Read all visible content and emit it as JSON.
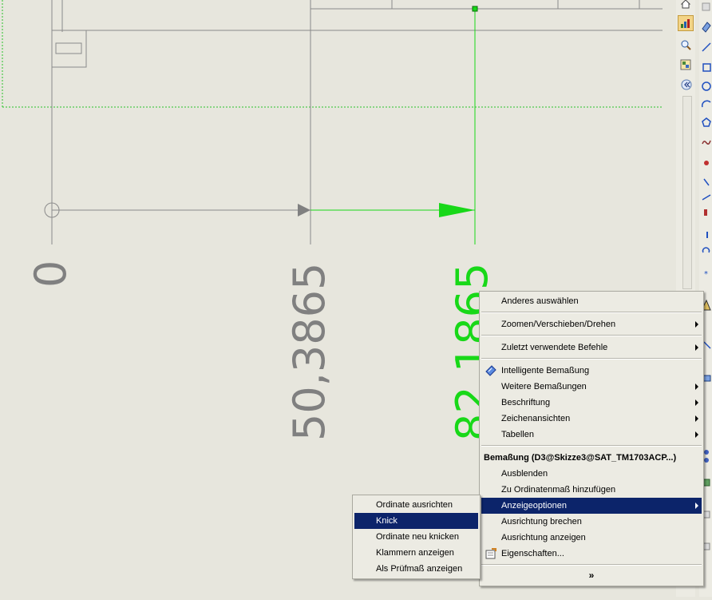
{
  "dimensions": [
    {
      "text": "0",
      "color": "gray"
    },
    {
      "text": "50,3865",
      "color": "gray"
    },
    {
      "text": "82,1865",
      "color": "green"
    }
  ],
  "colors": {
    "selection": "#18d818",
    "geometry": "#808080",
    "menu_highlight": "#0c246a"
  },
  "toolbar_icons": [
    "home-icon",
    "chart-icon",
    "zoom-icon",
    "view-icon",
    "collapse-icon"
  ],
  "context_menu": {
    "items": [
      {
        "label": "Anderes auswählen",
        "submenu": false
      },
      {
        "label": "Zoomen/Verschieben/Drehen",
        "submenu": true
      },
      {
        "label": "Zuletzt verwendete Befehle",
        "submenu": true
      },
      {
        "label": "Intelligente Bemaßung",
        "submenu": false,
        "icon": "smart-dimension-icon"
      },
      {
        "label": "Weitere Bemaßungen",
        "submenu": true
      },
      {
        "label": "Beschriftung",
        "submenu": true
      },
      {
        "label": "Zeichenansichten",
        "submenu": true
      },
      {
        "label": "Tabellen",
        "submenu": true
      },
      {
        "label": "Bemaßung (D3@Skizze3@SAT_TM1703ACP...)",
        "header": true
      },
      {
        "label": "Ausblenden",
        "submenu": false
      },
      {
        "label": "Zu Ordinatenmaß hinzufügen",
        "submenu": false
      },
      {
        "label": "Anzeigeoptionen",
        "submenu": true,
        "selected": true
      },
      {
        "label": "Ausrichtung brechen",
        "submenu": false
      },
      {
        "label": "Ausrichtung anzeigen",
        "submenu": false
      },
      {
        "label": "Eigenschaften...",
        "submenu": false,
        "icon": "properties-icon"
      }
    ],
    "expand": "»"
  },
  "submenu": {
    "items": [
      {
        "label": "Ordinate ausrichten"
      },
      {
        "label": "Knick",
        "selected": true
      },
      {
        "label": "Ordinate neu knicken"
      },
      {
        "label": "Klammern anzeigen"
      },
      {
        "label": "Als Prüfmaß anzeigen"
      }
    ]
  }
}
